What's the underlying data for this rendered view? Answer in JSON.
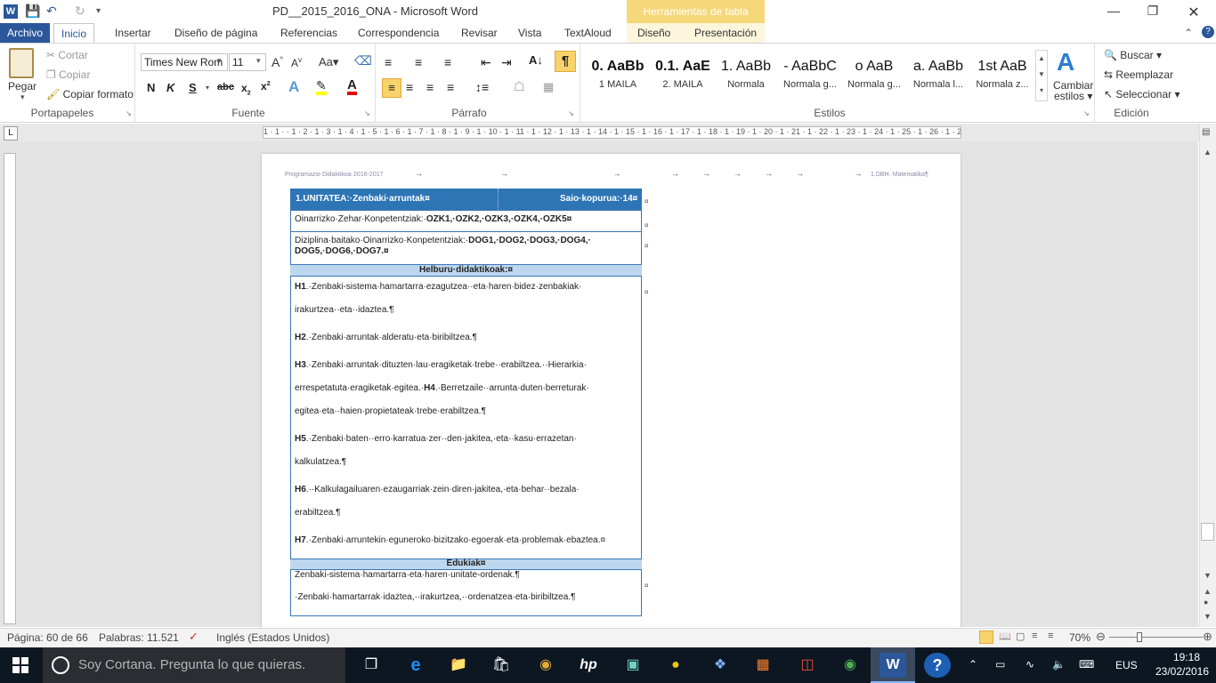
{
  "title": {
    "document": "PD__2015_2016_ONA",
    "separator": "-",
    "app": "Microsoft Word",
    "contextual_tab": "Herramientas de tabla"
  },
  "tabs": [
    "Archivo",
    "Inicio",
    "Insertar",
    "Diseño de página",
    "Referencias",
    "Correspondencia",
    "Revisar",
    "Vista",
    "TextAloud",
    "Diseño",
    "Presentación"
  ],
  "clipboard": {
    "paste": "Pegar",
    "cut": "Cortar",
    "copy": "Copiar",
    "format_painter": "Copiar formato",
    "label": "Portapapeles"
  },
  "font": {
    "name": "Times New Rom",
    "size": "11",
    "label": "Fuente"
  },
  "paragraph": {
    "label": "Párrafo"
  },
  "styles": {
    "label": "Estilos",
    "change_styles": "Cambiar estilos",
    "change_styles_l1": "Cambiar",
    "change_styles_l2": "estilos",
    "items": [
      {
        "preview": "0. AaBb",
        "name": "1 MAILA"
      },
      {
        "preview": "0.1. AaE",
        "name": "2. MAILA"
      },
      {
        "preview": "1. AaBb",
        "name": "Normala"
      },
      {
        "preview": "- AaBbC",
        "name": "Normala g..."
      },
      {
        "preview": "o AaB",
        "name": "Normala g..."
      },
      {
        "preview": "a. AaBb",
        "name": "Normala l..."
      },
      {
        "preview": "1st AaB",
        "name": "Normala z..."
      }
    ]
  },
  "editing": {
    "label": "Edición",
    "find": "Buscar",
    "replace": "Reemplazar",
    "select": "Seleccionar"
  },
  "ruler": {
    "marks": "1 · 1 · · 1 · 2 · 1 · 3 · 1 · 4 · 1 · 5 · 1 · 6 · 1 · 7 · 1 · 8 · 1 · 9 · 1 · 10 · 1 · 11 · 1 · 12 · 1 · 13 · 1 · 14 · 1 · 15 · 1 · 16 · 1 · 17 · 1 · 18 · 1 · 19 · 1 · 20 · 1 · 21 · 1 · 22 · 1 · 23 · 1 · 24 · 1 · 25 · 1 · 26 · 1 · 27 · 1 · 28 ·"
  },
  "doc": {
    "header_left": "Programazio·Didaktikoa·2016-2017",
    "header_right": "1.DBH.·Matematika¶",
    "unit_title": "1.UNITATEA:·Zenbaki·arruntak¤",
    "sessions": "Saio·kopurua:·14¤",
    "ozk_label": "Oinarrizko·Zehar·Konpetentziak:·",
    "ozk_values": "OZK1,·OZK2,·OZK3,·OZK4,·OZK5¤",
    "dog_label": "Diziplina·baitako·Oinarrizko·Konpetentziak:·",
    "dog_values_1": "DOG1,·DOG2,·DOG3,·DOG4,·",
    "dog_values_2": "DOG5,·DOG6,·DOG7.¤",
    "objectives_header": "Helburu·didaktikoak:¤",
    "objectives": [
      {
        "code": "H1",
        "l1": ".·Zenbaki-sistema·hamartarra·ezagutzea··eta·haren·bidez·zenbakiak·",
        "l2": "irakurtzea··eta··idaztea.¶"
      },
      {
        "code": "H2",
        "l1": ".·Zenbaki·arruntak·alderatu·eta·biribiltzea.¶",
        "l2": ""
      },
      {
        "code": "H3",
        "l1": ".·Zenbaki·arruntak·dituzten·lau·eragiketak·trebe··erabiltzea.··Hierarkia·",
        "l2": "errespetatuta·eragiketak·egitea.·",
        "code2": "H4",
        "l2b": ".·Berretzaile··arrunta·duten·berreturak·",
        "l3": "egitea·eta··haien·propietateak·trebe·erabiltzea.¶"
      },
      {
        "code": "H5",
        "l1": ".·Zenbaki·baten··erro·karratua·zer··den·jakitea,·eta··kasu·errazetan·",
        "l2": "kalkulatzea.¶"
      },
      {
        "code": "H6",
        "l1": ".··Kalkulagailuaren·ezaugarriak·zein·diren·jakitea,·eta·behar··bezala·",
        "l2": "erabiltzea.¶"
      },
      {
        "code": "H7",
        "l1": ".·Zenbaki·arruntekin·eguneroko·bizitzako·egoerak·eta·problemak·ebaztea.¤",
        "l2": ""
      }
    ],
    "contents_header": "Edukiak¤",
    "contents": [
      "Zenbaki-sistema·hamartarra·eta·haren·unitate-ordenak.¶",
      "·Zenbaki·hamartarrak·idaztea,··irakurtzea,··ordenatzea·eta·biribiltzea.¶"
    ],
    "cell_mark": "¤"
  },
  "status": {
    "page": "Página: 60 de 66",
    "words": "Palabras: 11.521",
    "language": "Inglés (Estados Unidos)",
    "zoom": "70%"
  },
  "taskbar": {
    "cortana": "Soy Cortana. Pregunta lo que quieras.",
    "lang": "EUS",
    "time": "19:18",
    "date": "23/02/2016"
  }
}
